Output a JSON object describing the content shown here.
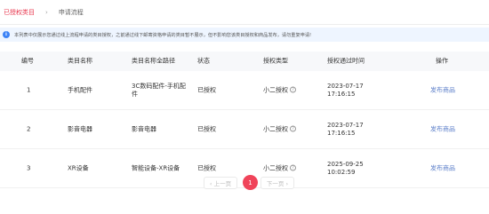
{
  "breadcrumb": {
    "current": "已授权类目",
    "separator": "›",
    "next": "申请流程"
  },
  "notice": {
    "icon": "info-icon",
    "text": "本列表中仅展示您通过线上流程申请的类目授权，之前通过线下邮寄资格申请的类目暂不展示，但不影响您该类目授权和商品发布，请勿重复申请!"
  },
  "table": {
    "headers": [
      "编号",
      "类目名称",
      "类目名称全路径",
      "状态",
      "授权类型",
      "授权通过时间",
      "操作"
    ],
    "rows": [
      {
        "idx": "1",
        "name": "手机配件",
        "path": "3C数码配件-手机配件",
        "status": "已授权",
        "type": "小二授权",
        "time": "2023-07-17 17:16:15",
        "op": "发布商品"
      },
      {
        "idx": "2",
        "name": "影音电器",
        "path": "影音电器",
        "status": "已授权",
        "type": "小二授权",
        "time": "2023-07-17 17:16:15",
        "op": "发布商品"
      },
      {
        "idx": "3",
        "name": "XR设备",
        "path": "智能设备-XR设备",
        "status": "已授权",
        "type": "小二授权",
        "time": "2025-09-25 10:02:59",
        "op": "发布商品"
      }
    ]
  },
  "pagination": {
    "prev": "‹ 上一页",
    "current": "1",
    "next": "下一页 ›"
  },
  "colors": {
    "accent": "#f0445a",
    "link": "#5b7ec9",
    "notice_bg": "#eef5ff"
  }
}
